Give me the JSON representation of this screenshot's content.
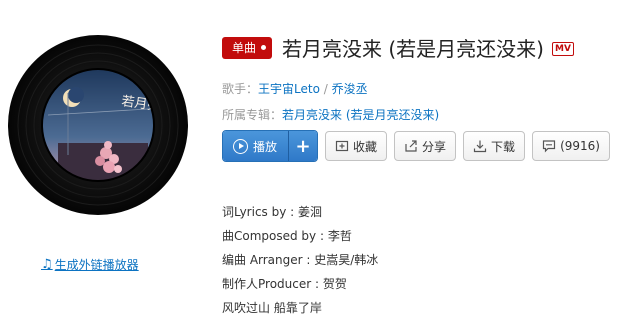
{
  "player_link": {
    "label": "生成外链播放器",
    "icon": "music-note-icon"
  },
  "cover": {
    "art_text": "若月亮没来",
    "colors": {
      "sky": "#1f3b63",
      "moon": "#f2dfb8",
      "blossom": "#e8a7b5",
      "vinyl": "#0d0d0d"
    }
  },
  "header": {
    "badge": "单曲",
    "title": "若月亮没来 (若是月亮还没来)",
    "mv_label": "MV"
  },
  "meta": {
    "artist_label": "歌手：",
    "artist_1": "王宇宙Leto",
    "artist_sep": " / ",
    "artist_2": "乔浚丞",
    "album_label": "所属专辑：",
    "album": "若月亮没来 (若是月亮还没来)"
  },
  "actions": {
    "play": "播放",
    "add": "+",
    "collect": "收藏",
    "share": "分享",
    "download": "下载",
    "comment": "(9916)"
  },
  "lyrics": [
    "词Lyrics by : 姜洄",
    "曲Composed by : 李哲",
    "编曲 Arranger : 史嵩昊/韩冰",
    "制作人Producer : 贺贺",
    "风吹过山 船靠了岸"
  ],
  "accent": {
    "red": "#c20c0c",
    "blue": "#0c73c2",
    "play_blue": "#3a86d2"
  }
}
